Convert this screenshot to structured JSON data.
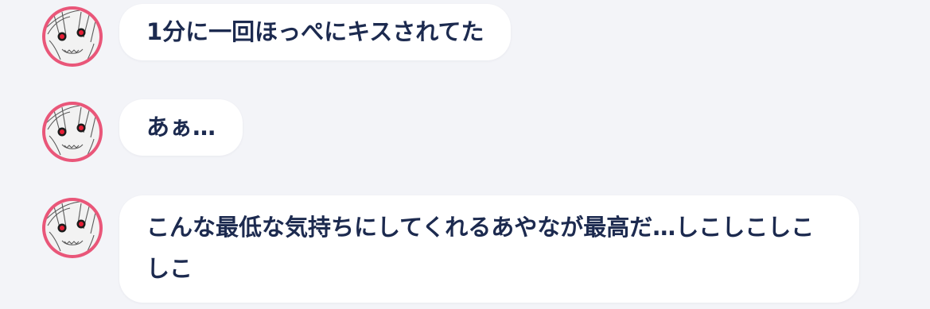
{
  "theme": {
    "background": "#f3f4f8",
    "bubble_color": "#ffffff",
    "text_color": "#1c2a4f",
    "avatar_ring": "#e95679"
  },
  "messages": [
    {
      "avatar_icon": "anime-character-avatar-icon",
      "text": "1分に一回ほっぺにキスされてた"
    },
    {
      "avatar_icon": "anime-character-avatar-icon",
      "text": "あぁ…"
    },
    {
      "avatar_icon": "anime-character-avatar-icon",
      "text": "こんな最低な気持ちにしてくれるあやなが最高だ…しこしこしこしこ"
    }
  ]
}
